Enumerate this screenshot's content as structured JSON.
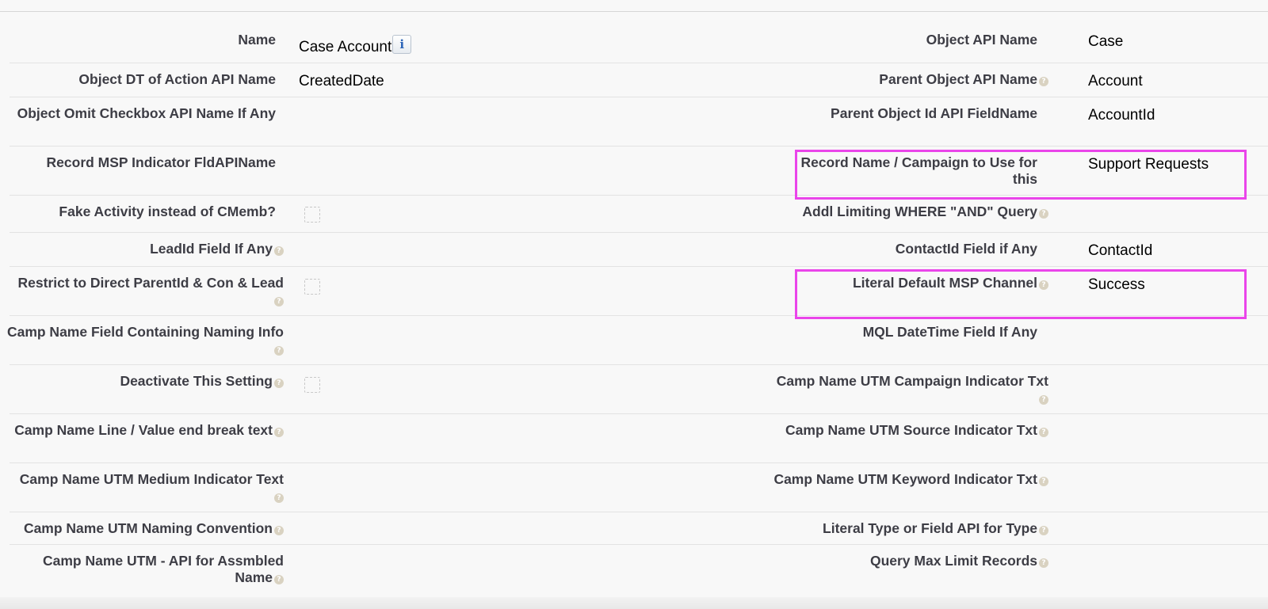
{
  "rows": [
    {
      "left_label": "Name",
      "left_value": "Case Account",
      "right_label": "Object API Name",
      "right_value": "Case"
    },
    {
      "left_label": "Object DT of Action API Name",
      "left_value": "CreatedDate",
      "right_label": "Parent Object API Name",
      "right_value": "Account"
    },
    {
      "left_label": "Object Omit Checkbox API Name If Any",
      "left_value": "",
      "right_label": "Parent Object Id API FieldName",
      "right_value": "AccountId"
    },
    {
      "left_label": "Record MSP Indicator FldAPIName",
      "left_value": "",
      "right_label": "Record Name / Campaign to Use for this",
      "right_value": "Support Requests"
    },
    {
      "left_label": "Fake Activity instead of CMemb?",
      "left_value": "",
      "right_label": "Addl Limiting WHERE \"AND\" Query",
      "right_value": ""
    },
    {
      "left_label": "LeadId Field If Any",
      "left_value": "",
      "right_label": "ContactId Field if Any",
      "right_value": "ContactId"
    },
    {
      "left_label": "Restrict to Direct ParentId & Con & Lead",
      "left_value": "",
      "right_label": "Literal Default MSP Channel",
      "right_value": "Success"
    },
    {
      "left_label": "Camp Name Field Containing Naming Info",
      "left_value": "",
      "right_label": "MQL DateTime Field If Any",
      "right_value": ""
    },
    {
      "left_label": "Deactivate This Setting",
      "left_value": "",
      "right_label": "Camp Name UTM Campaign Indicator Txt",
      "right_value": ""
    },
    {
      "left_label": "Camp Name Line / Value end break text",
      "left_value": "",
      "right_label": "Camp Name UTM Source Indicator Txt",
      "right_value": ""
    },
    {
      "left_label": "Camp Name UTM Medium Indicator Text",
      "left_value": "",
      "right_label": "Camp Name UTM Keyword Indicator Txt",
      "right_value": ""
    },
    {
      "left_label": "Camp Name UTM Naming Convention",
      "left_value": "",
      "right_label": "Literal Type or Field API for Type",
      "right_value": ""
    },
    {
      "left_label": "Camp Name UTM - API for Assmbled Name",
      "left_value": "",
      "right_label": "Query Max Limit Records",
      "right_value": ""
    }
  ],
  "icons": {
    "help": "help-icon",
    "info": "info-icon"
  },
  "help_glyph": "?",
  "info_glyph": "i",
  "colors": {
    "highlight": "#ea45ea",
    "label": "#3d3d45"
  }
}
